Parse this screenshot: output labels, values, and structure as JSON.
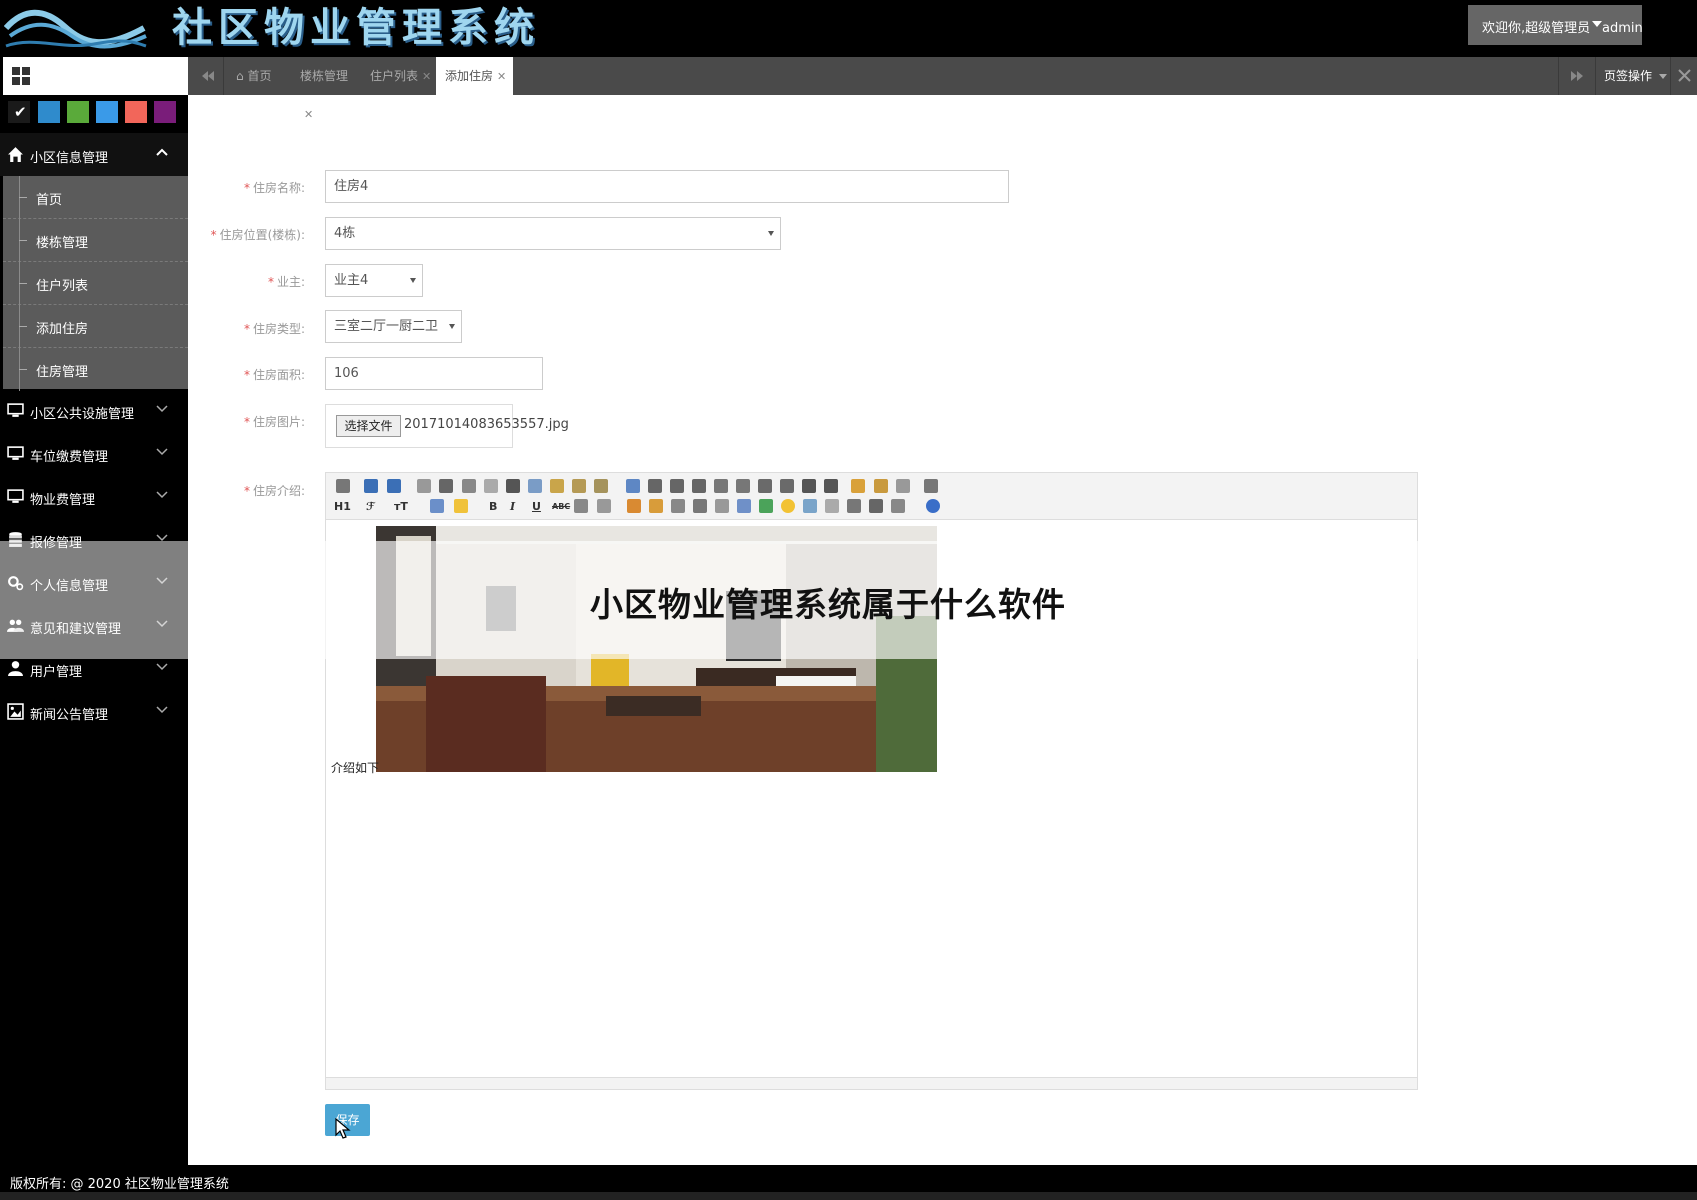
{
  "header": {
    "title": "社区物业管理系统",
    "welcome": "欢迎你,超级管理员",
    "username": "admin"
  },
  "theme_swatches": [
    "#1a1a1a",
    "#2f8bcc",
    "#5aaa3a",
    "#3a9ae8",
    "#f2665a",
    "#7a1d7a"
  ],
  "sidebar": {
    "groups": [
      {
        "label": "小区信息管理",
        "icon": "home-icon",
        "expanded": true
      },
      {
        "label": "小区公共设施管理",
        "icon": "monitor-icon"
      },
      {
        "label": "车位缴费管理",
        "icon": "monitor-icon"
      },
      {
        "label": "物业费管理",
        "icon": "monitor-icon"
      },
      {
        "label": "报修管理",
        "icon": "database-icon"
      },
      {
        "label": "个人信息管理",
        "icon": "gears-icon"
      },
      {
        "label": "意见和建议管理",
        "icon": "users-icon"
      },
      {
        "label": "用户管理",
        "icon": "user-icon"
      },
      {
        "label": "新闻公告管理",
        "icon": "image-icon"
      }
    ],
    "sub_items": [
      {
        "label": "首页"
      },
      {
        "label": "楼栋管理"
      },
      {
        "label": "住户列表"
      },
      {
        "label": "添加住房"
      },
      {
        "label": "住房管理"
      }
    ]
  },
  "tabs": [
    {
      "label": "首页",
      "closable": false
    },
    {
      "label": "楼栋管理",
      "closable": true
    },
    {
      "label": "住户列表",
      "closable": true
    },
    {
      "label": "添加住房",
      "closable": true,
      "active": true
    }
  ],
  "tab_ops_label": "页签操作",
  "form": {
    "name_label": "住房名称:",
    "name_value": "住房4",
    "location_label": "住房位置(楼栋):",
    "location_value": "4栋",
    "owner_label": "业主:",
    "owner_value": "业主4",
    "type_label": "住房类型:",
    "type_value": "三室二厅一厨二卫",
    "area_label": "住房面积:",
    "area_value": "106",
    "image_label": "住房图片:",
    "file_button": "选择文件",
    "file_name": "20171014083653557.jpg",
    "intro_label": "住房介绍:",
    "intro_text": "介绍如下",
    "save_label": "保存"
  },
  "toolbar": {
    "heading_label": "H1",
    "font_label": "ℱ",
    "size_label": "тT",
    "bold": "B",
    "italic": "I",
    "underline": "U",
    "strike": "ABC"
  },
  "overlay": {
    "title": "小区物业管理系统属于什么软件"
  },
  "footer": {
    "copyright": "版权所有:  @ 2020 社区物业管理系统"
  }
}
